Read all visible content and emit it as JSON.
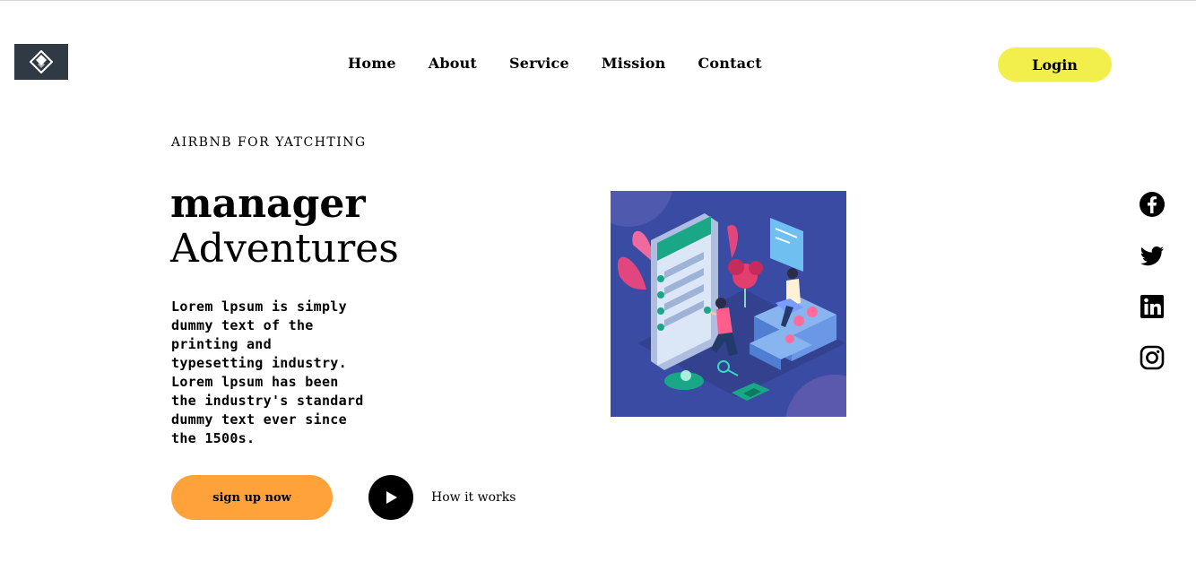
{
  "nav": {
    "items": [
      {
        "label": "Home"
      },
      {
        "label": "About"
      },
      {
        "label": "Service"
      },
      {
        "label": "Mission"
      },
      {
        "label": "Contact"
      }
    ],
    "login_label": "Login"
  },
  "hero": {
    "eyebrow": "AIRBNB FOR YATCHTING",
    "title_line1": "manager",
    "title_line2": "Adventures",
    "description": "Lorem lpsum is simply dummy text of the printing and typesetting industry. Lorem lpsum has been the industry's standard dummy text ever since the 1500s.",
    "signup_label": "sign up now",
    "how_label": "How it works"
  },
  "icons": {
    "logo": "logo-icon",
    "play": "play-icon",
    "social": [
      "facebook-icon",
      "twitter-icon",
      "linkedin-icon",
      "instagram-icon"
    ]
  },
  "colors": {
    "login_bg": "#f2ef4d",
    "signup_bg": "#ffa23a",
    "illustration_bg": "#3a4ba3"
  }
}
